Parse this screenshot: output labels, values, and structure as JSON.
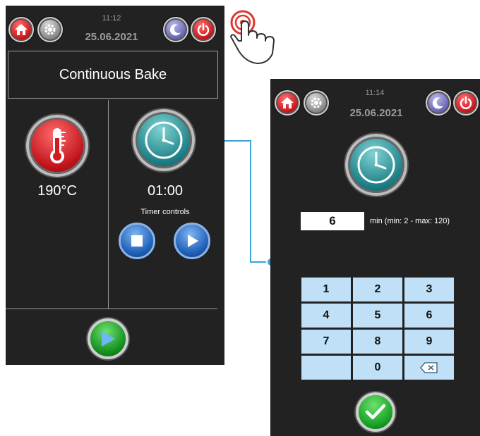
{
  "screen_main": {
    "time": "11:12",
    "date": "25.06.2021",
    "mode_title": "Continuous Bake",
    "temperature": "190°C",
    "timer": "01:00",
    "timer_controls_label": "Timer controls"
  },
  "screen_timer": {
    "time": "11:14",
    "date": "25.06.2021",
    "input_value": "6",
    "range_hint": "min (min: 2 - max: 120)",
    "keys": [
      "1",
      "2",
      "3",
      "4",
      "5",
      "6",
      "7",
      "8",
      "9",
      "",
      "0"
    ]
  },
  "icons": {
    "home": "home-icon",
    "settings": "gear-icon",
    "night": "moon-icon",
    "power": "power-icon",
    "temperature": "thermometer-icon",
    "timer": "clock-icon",
    "stop": "stop-icon",
    "play": "play-icon",
    "backspace": "backspace-icon",
    "confirm": "checkmark-icon",
    "tap": "hand-tap-icon"
  },
  "colors": {
    "panel_bg": "#222222",
    "accent_red": "#c70f14",
    "accent_teal": "#1d7f86",
    "accent_blue": "#1f5fb8",
    "accent_green": "#15901f",
    "connector": "#3aa3d8",
    "keypad_key": "#bfe0f7"
  }
}
